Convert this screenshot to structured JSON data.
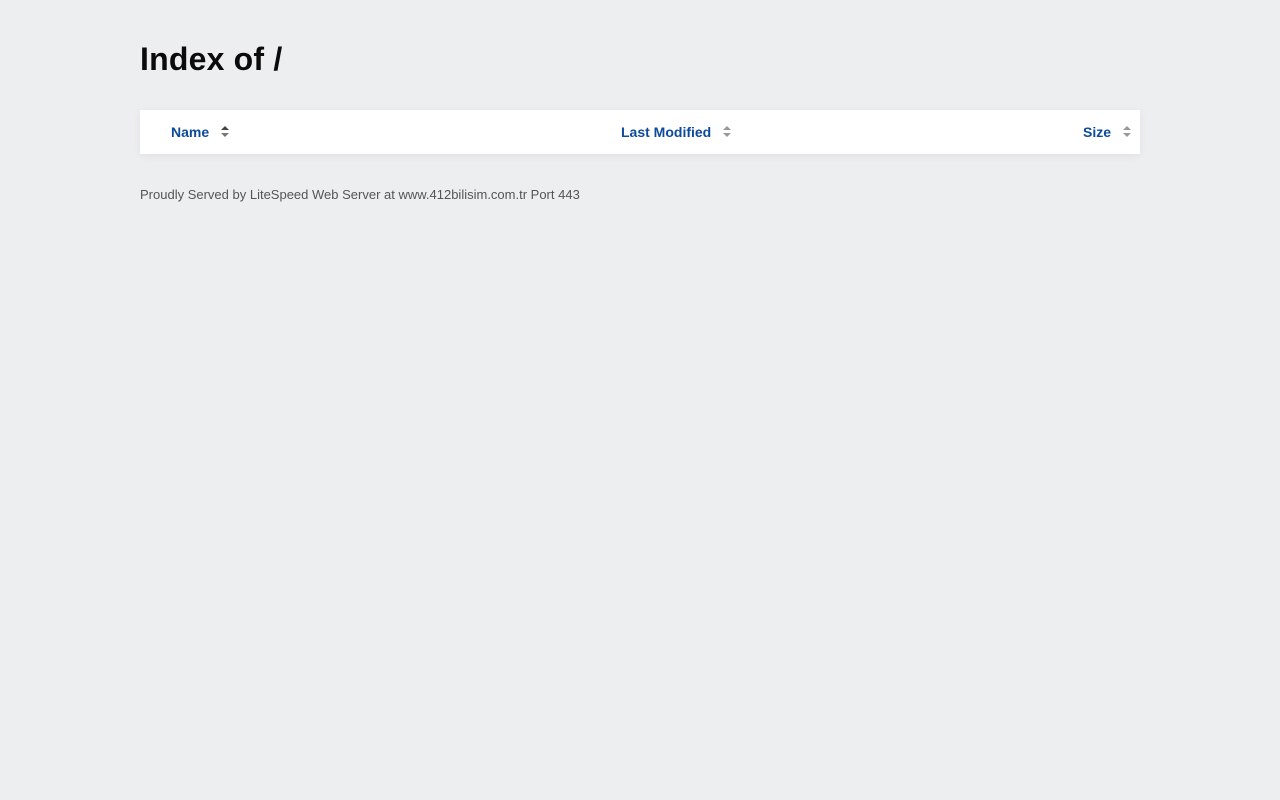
{
  "page": {
    "title": "Index of /"
  },
  "table": {
    "columns": [
      {
        "label": "Name",
        "sort_active": true
      },
      {
        "label": "Last Modified",
        "sort_active": false
      },
      {
        "label": "Size",
        "sort_active": false
      }
    ],
    "rows": []
  },
  "footer": {
    "text": "Proudly Served by LiteSpeed Web Server at www.412bilisim.com.tr Port 443"
  },
  "colors": {
    "background": "#edeef0",
    "header_link": "#0c4a9c"
  }
}
